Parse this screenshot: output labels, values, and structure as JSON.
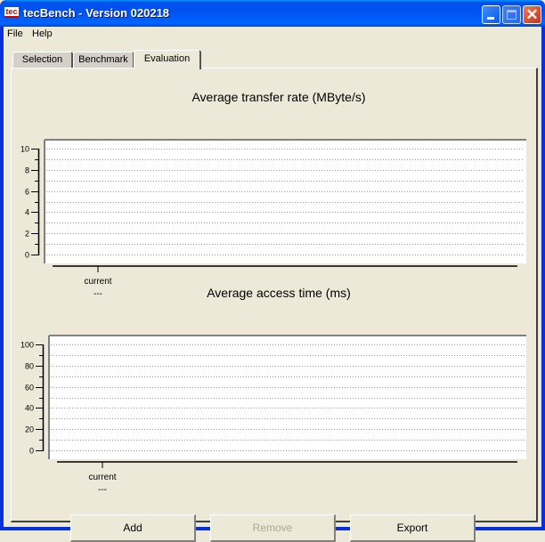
{
  "window": {
    "title": "tecBench - Version 020218",
    "icon_text": "tec"
  },
  "menu": [
    "File",
    "Help"
  ],
  "tabs": [
    {
      "label": "Selection",
      "active": false
    },
    {
      "label": "Benchmark",
      "active": false
    },
    {
      "label": "Evaluation",
      "active": true
    }
  ],
  "buttons": {
    "add": "Add",
    "remove": "Remove",
    "export": "Export"
  },
  "chart_data": [
    {
      "type": "bar",
      "title": "Average transfer rate (MByte/s)",
      "categories": [
        "current"
      ],
      "category_sublabels": [
        "---"
      ],
      "values": [],
      "ylim": [
        0,
        10
      ],
      "yticks": [
        0,
        2,
        4,
        6,
        8,
        10
      ],
      "grid": true
    },
    {
      "type": "bar",
      "title": "Average access time (ms)",
      "categories": [
        "current"
      ],
      "category_sublabels": [
        "---"
      ],
      "values": [],
      "ylim": [
        0,
        100
      ],
      "yticks": [
        0,
        20,
        40,
        60,
        80,
        100
      ],
      "grid": true
    }
  ]
}
